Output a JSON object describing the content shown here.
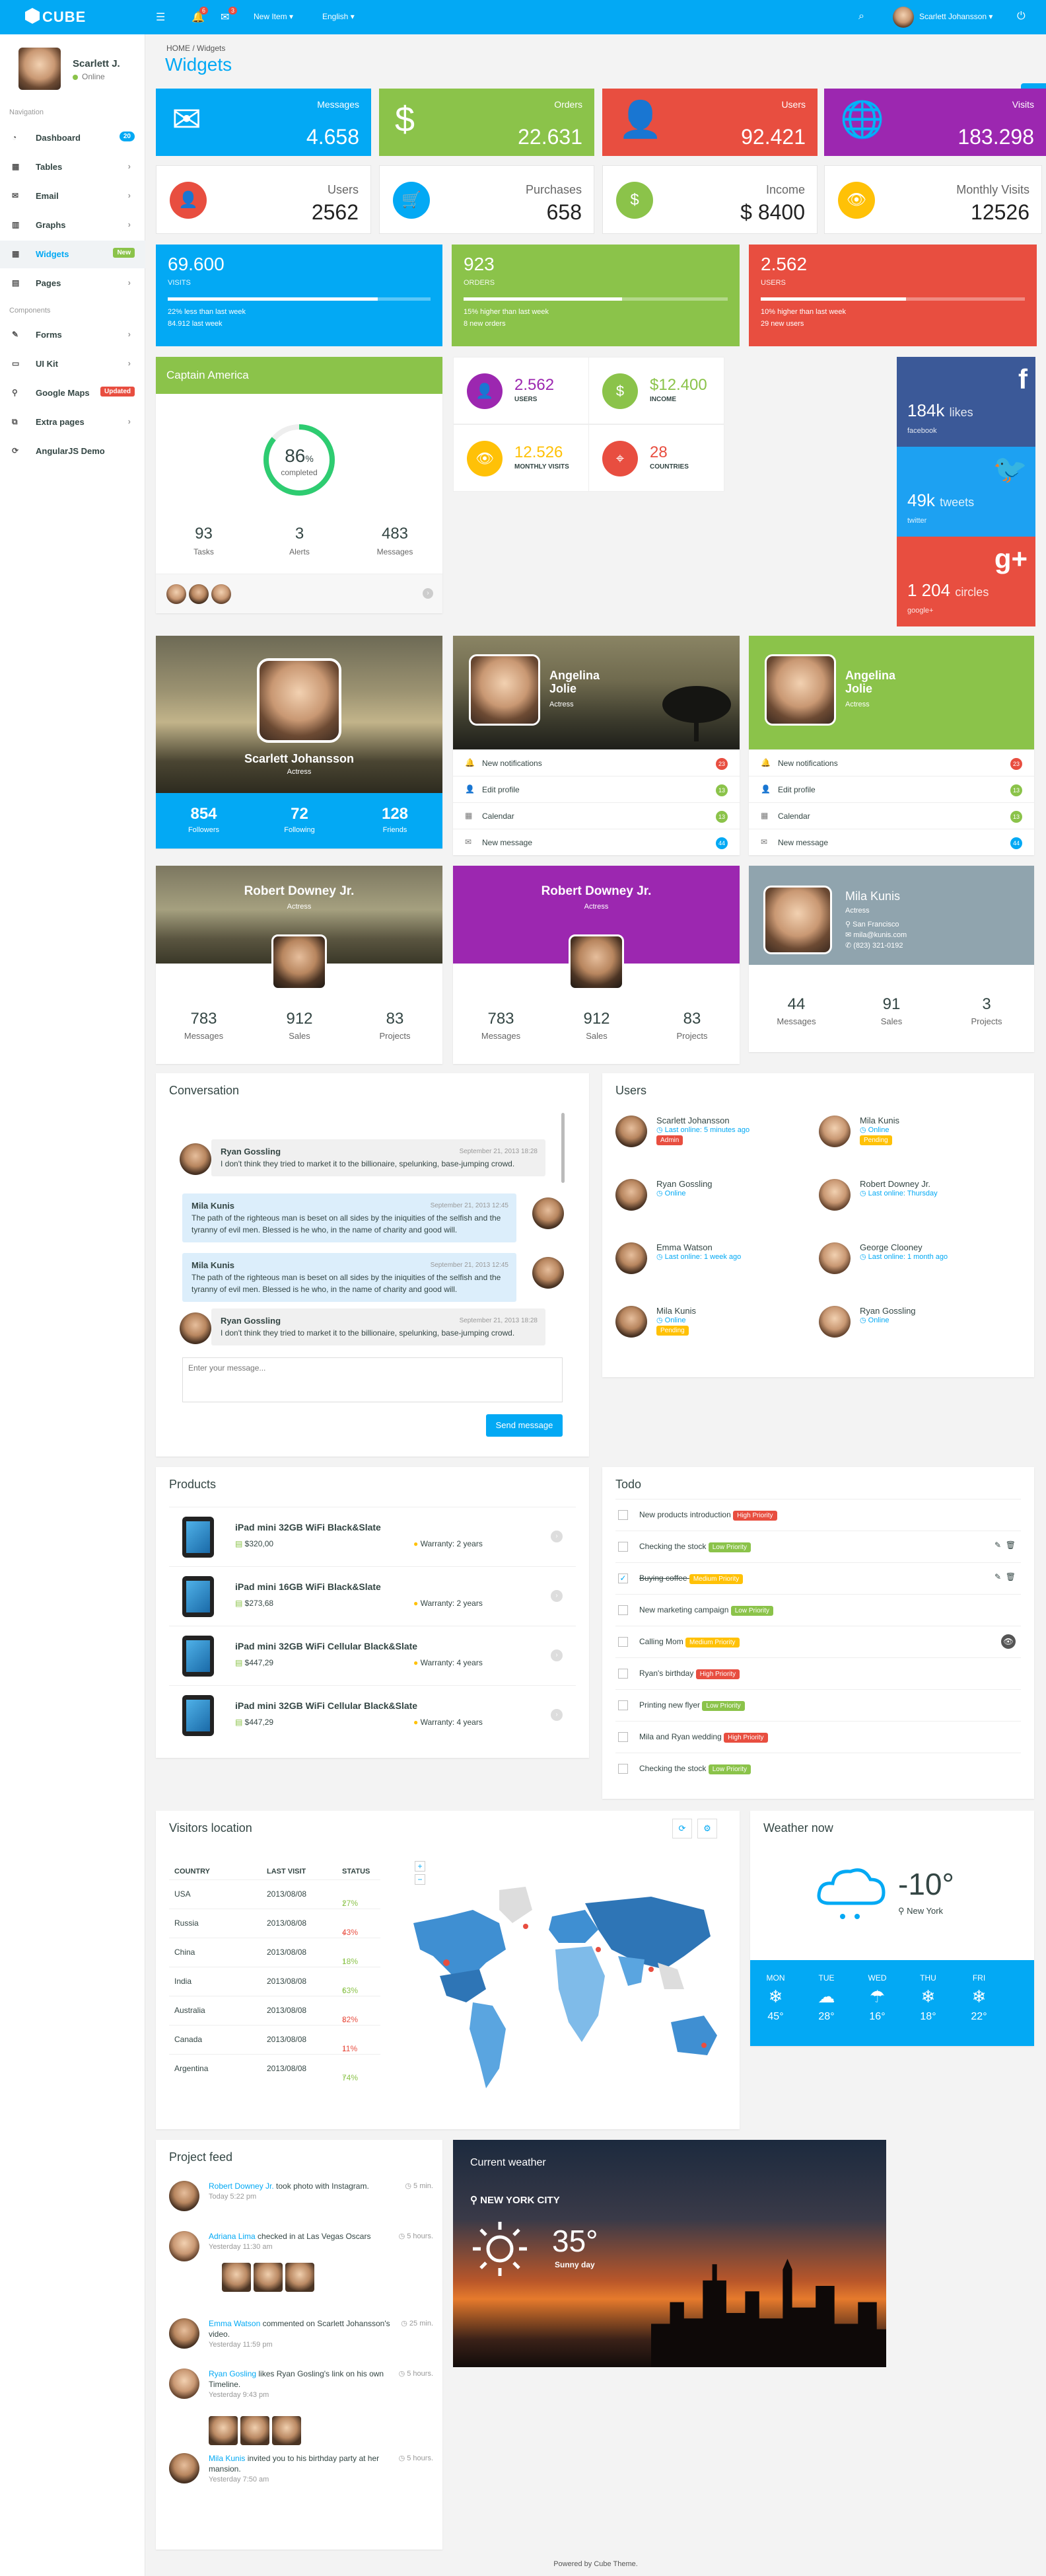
{
  "nav": {
    "logo": "CUBE",
    "new_item": "New Item",
    "language": "English",
    "user": "Scarlett Johansson",
    "notif_count": "6",
    "msg_count": "3"
  },
  "sidebar": {
    "user_name": "Scarlett J.",
    "user_status": "Online",
    "sec_navigation": "Navigation",
    "sec_components": "Components",
    "items": [
      {
        "label": "Dashboard",
        "tag": "20"
      },
      {
        "label": "Tables"
      },
      {
        "label": "Email"
      },
      {
        "label": "Graphs"
      },
      {
        "label": "Widgets",
        "tag": "New"
      },
      {
        "label": "Pages"
      },
      {
        "label": "Forms"
      },
      {
        "label": "UI Kit"
      },
      {
        "label": "Google Maps",
        "tag": "Updated"
      },
      {
        "label": "Extra pages"
      },
      {
        "label": "AngularJS Demo"
      }
    ]
  },
  "breadcrumb": {
    "home": "HOME",
    "current": "Widgets"
  },
  "page_title": "Widgets",
  "tiles": [
    {
      "label": "Messages",
      "value": "4.658",
      "color": "#03a9f4"
    },
    {
      "label": "Orders",
      "value": "22.631",
      "color": "#8bc34a"
    },
    {
      "label": "Users",
      "value": "92.421",
      "color": "#e84e40"
    },
    {
      "label": "Visits",
      "value": "183.298",
      "color": "#9c27b0"
    }
  ],
  "btiles": [
    {
      "label": "Users",
      "value": "2562",
      "color": "#e84e40"
    },
    {
      "label": "Purchases",
      "value": "658",
      "color": "#03a9f4"
    },
    {
      "label": "Income",
      "value": "$ 8400",
      "color": "#8bc34a"
    },
    {
      "label": "Monthly Visits",
      "value": "12526",
      "color": "#ffc107"
    }
  ],
  "stats": [
    {
      "value": "69.600",
      "name": "Visits",
      "line1": "22% less than last week",
      "line2": "84.912 last week",
      "fill": 0.8,
      "color": "#03a9f4"
    },
    {
      "value": "923",
      "name": "Orders",
      "line1": "15% higher than last week",
      "line2": "8 new orders",
      "fill": 0.6,
      "color": "#8bc34a"
    },
    {
      "value": "2.562",
      "name": "Users",
      "line1": "10% higher than last week",
      "line2": "29 new users",
      "fill": 0.55,
      "color": "#e84e40"
    }
  ],
  "captain": {
    "title": "Captain America",
    "percent": "86",
    "pct_sign": "%",
    "completed": "completed",
    "tasks_v": "93",
    "tasks": "Tasks",
    "alerts_v": "3",
    "alerts": "Alerts",
    "msgs_v": "483",
    "msgs": "Messages",
    "progress": 0.86
  },
  "mini": [
    {
      "value": "2.562",
      "label": "Users",
      "color": "#9c27b0"
    },
    {
      "value": "$12.400",
      "label": "Income",
      "color": "#8bc34a"
    },
    {
      "value": "12.526",
      "label": "Monthly visits",
      "color": "#ffc107"
    },
    {
      "value": "28",
      "label": "Countries",
      "color": "#e84e40"
    }
  ],
  "social": [
    {
      "count": "184k",
      "unit": "likes",
      "name": "facebook",
      "color": "#3b5998"
    },
    {
      "count": "49k",
      "unit": "tweets",
      "name": "twitter",
      "color": "#1da1f2"
    },
    {
      "count": "1 204",
      "unit": "circles",
      "name": "google+",
      "color": "#e84e40"
    }
  ],
  "prof1": {
    "name": "Scarlett Johansson",
    "role": "Actress",
    "followers_v": "854",
    "followers": "Followers",
    "following_v": "72",
    "following": "Following",
    "friends_v": "128",
    "friends": "Friends"
  },
  "prof2": {
    "name": "Angelina Jolie",
    "role": "Actress"
  },
  "prof3": {
    "name": "Angelina Jolie",
    "role": "Actress"
  },
  "notif": [
    {
      "label": "New notifications",
      "count": "23",
      "color": "#e84e40"
    },
    {
      "label": "Edit profile",
      "count": "13",
      "color": "#8bc34a"
    },
    {
      "label": "Calendar",
      "count": "13",
      "color": "#8bc34a"
    },
    {
      "label": "New message",
      "count": "44",
      "color": "#03a9f4"
    }
  ],
  "prof4": {
    "name": "Robert Downey Jr.",
    "role": "Actress",
    "m_v": "783",
    "m": "Messages",
    "s_v": "912",
    "s": "Sales",
    "p_v": "83",
    "p": "Projects"
  },
  "prof5": {
    "name": "Robert Downey Jr.",
    "role": "Actress",
    "m_v": "783",
    "m": "Messages",
    "s_v": "912",
    "s": "Sales",
    "p_v": "83",
    "p": "Projects"
  },
  "prof6": {
    "name": "Mila Kunis",
    "role": "Actress",
    "city": "San Francisco",
    "email": "mila@kunis.com",
    "phone": "(823) 321-0192",
    "m_v": "44",
    "m": "Messages",
    "s_v": "91",
    "s": "Sales",
    "p_v": "3",
    "p": "Projects"
  },
  "conversation": {
    "title": "Conversation",
    "placeholder": "Enter your message...",
    "send": "Send message",
    "messages": [
      {
        "who": "Ryan Gossling",
        "when": "September 21, 2013 18:28",
        "text": "I don't think they tried to market it to the billionaire, spelunking, base-jumping crowd."
      },
      {
        "who": "Mila Kunis",
        "when": "September 21, 2013 12:45",
        "text": "The path of the righteous man is beset on all sides by the iniquities of the selfish and the tyranny of evil men. Blessed is he who, in the name of charity and good will."
      },
      {
        "who": "Mila Kunis",
        "when": "September 21, 2013 12:45",
        "text": "The path of the righteous man is beset on all sides by the iniquities of the selfish and the tyranny of evil men. Blessed is he who, in the name of charity and good will."
      },
      {
        "who": "Ryan Gossling",
        "when": "September 21, 2013 18:28",
        "text": "I don't think they tried to market it to the billionaire, spelunking, base-jumping crowd."
      }
    ]
  },
  "users": {
    "title": "Users",
    "list": [
      {
        "name": "Scarlett Johansson",
        "status": "Last online: 5 minutes ago",
        "tag": "Admin",
        "tagc": "#e84e40"
      },
      {
        "name": "Mila Kunis",
        "status": "Online",
        "tag": "Pending",
        "tagc": "#ffc107"
      },
      {
        "name": "Ryan Gossling",
        "status": "Online"
      },
      {
        "name": "Robert Downey Jr.",
        "status": "Last online: Thursday"
      },
      {
        "name": "Emma Watson",
        "status": "Last online: 1 week ago"
      },
      {
        "name": "George Clooney",
        "status": "Last online: 1 month ago"
      },
      {
        "name": "Mila Kunis",
        "status": "Online",
        "tag": "Pending",
        "tagc": "#ffc107"
      },
      {
        "name": "Ryan Gossling",
        "status": "Online"
      }
    ]
  },
  "products": {
    "title": "Products",
    "list": [
      {
        "name": "iPad mini 32GB WiFi Black&Slate",
        "price": "$320,00",
        "warranty": "Warranty: 2 years"
      },
      {
        "name": "iPad mini 16GB WiFi Black&Slate",
        "price": "$273,68",
        "warranty": "Warranty: 2 years"
      },
      {
        "name": "iPad mini 32GB WiFi Cellular Black&Slate",
        "price": "$447,29",
        "warranty": "Warranty: 4 years"
      },
      {
        "name": "iPad mini 32GB WiFi Cellular Black&Slate",
        "price": "$447,29",
        "warranty": "Warranty: 4 years"
      }
    ]
  },
  "todo": {
    "title": "Todo",
    "list": [
      {
        "text": "New products introduction",
        "tag": "High Priority",
        "c": "#e84e40"
      },
      {
        "text": "Checking the stock",
        "tag": "Low Priority",
        "c": "#8bc34a"
      },
      {
        "text": "Buying coffee",
        "tag": "Medium Priority",
        "c": "#ffc107",
        "done": true
      },
      {
        "text": "New marketing campaign",
        "tag": "Low Priority",
        "c": "#8bc34a"
      },
      {
        "text": "Calling Mom",
        "tag": "Medium Priority",
        "c": "#ffc107"
      },
      {
        "text": "Ryan's birthday",
        "tag": "High Priority",
        "c": "#e84e40"
      },
      {
        "text": "Printing new flyer",
        "tag": "Low Priority",
        "c": "#8bc34a"
      },
      {
        "text": "Mila and Ryan wedding",
        "tag": "High Priority",
        "c": "#e84e40"
      },
      {
        "text": "Checking the stock",
        "tag": "Low Priority",
        "c": "#8bc34a"
      }
    ]
  },
  "visitors": {
    "title": "Visitors location",
    "cols": [
      "COUNTRY",
      "LAST VISIT",
      "STATUS"
    ],
    "rows": [
      {
        "country": "USA",
        "date": "2013/08/08",
        "status": "27%",
        "up": true
      },
      {
        "country": "Russia",
        "date": "2013/08/08",
        "status": "43%",
        "up": false
      },
      {
        "country": "China",
        "date": "2013/08/08",
        "status": "18%",
        "up": true
      },
      {
        "country": "India",
        "date": "2013/08/08",
        "status": "63%",
        "up": true
      },
      {
        "country": "Australia",
        "date": "2013/08/08",
        "status": "82%",
        "up": false
      },
      {
        "country": "Canada",
        "date": "2013/08/08",
        "status": "11%",
        "up": false
      },
      {
        "country": "Argentina",
        "date": "2013/08/08",
        "status": "74%",
        "up": true
      }
    ]
  },
  "weather": {
    "title": "Weather now",
    "temp": "-10°",
    "city": "New York",
    "days": [
      {
        "d": "MON",
        "t": "45°"
      },
      {
        "d": "TUE",
        "t": "28°"
      },
      {
        "d": "WED",
        "t": "16°"
      },
      {
        "d": "THU",
        "t": "18°"
      },
      {
        "d": "FRI",
        "t": "22°"
      }
    ]
  },
  "feed": {
    "title": "Project feed",
    "items": [
      {
        "who": "Robert Downey Jr.",
        "text": " took photo with Instagram.",
        "time": "Today 5:22 pm",
        "ago": "5 min."
      },
      {
        "who": "Adriana Lima",
        "text": " checked in at Las Vegas Oscars",
        "time": "Yesterday 11:30 am",
        "ago": "5 hours."
      },
      {
        "who": "Emma Watson",
        "text": " commented on Scarlett Johansson's video.",
        "time": "Yesterday 11:59 pm",
        "ago": "25 min."
      },
      {
        "who": "Ryan Gosling",
        "text": " likes Ryan Gosling's link on his own Timeline.",
        "time": "Yesterday 9:43 pm",
        "ago": "5 hours."
      },
      {
        "who": "Mila Kunis",
        "text": " invited you to his birthday party at her mansion.",
        "time": "Yesterday 7:50 am",
        "ago": "5 hours."
      }
    ]
  },
  "current_weather": {
    "title": "Current weather",
    "city": "NEW YORK CITY",
    "temp": "35°",
    "cond": "Sunny day"
  },
  "footer": "Powered by Cube Theme."
}
